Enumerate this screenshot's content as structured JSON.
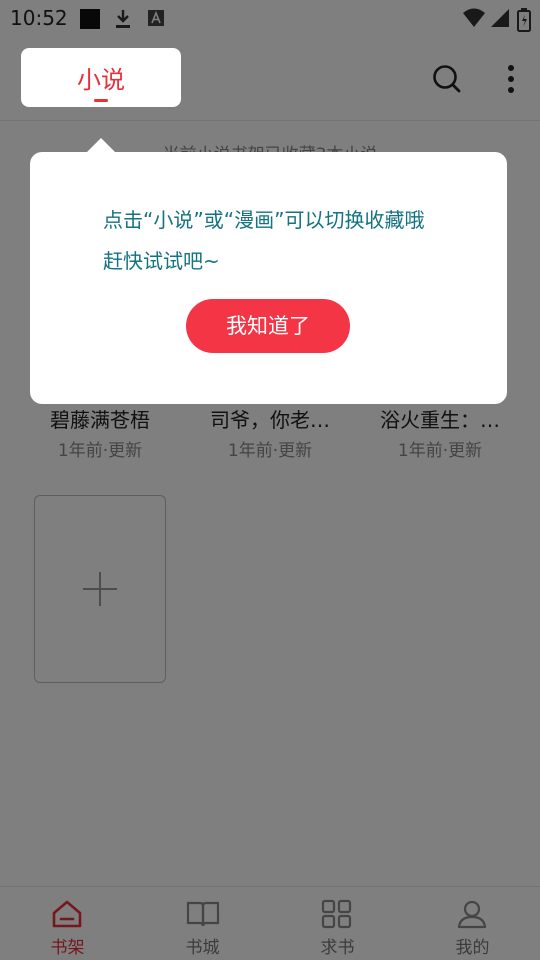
{
  "status_bar": {
    "time": "10:52"
  },
  "top_bar": {
    "active_tab": "小说"
  },
  "shelf": {
    "hint": "当前小说书架已收藏3本小说",
    "books": [
      {
        "title": "碧藤满苍梧",
        "updated": "1年前·更新"
      },
      {
        "title": "司爷，你老…",
        "updated": "1年前·更新"
      },
      {
        "title": "浴火重生：…",
        "updated": "1年前·更新"
      }
    ]
  },
  "dialog": {
    "line1": "点击“小说”或“漫画”可以切换收藏哦",
    "line2": "赶快试试吧~",
    "button": "我知道了"
  },
  "bottom_nav": {
    "items": [
      {
        "label": "书架",
        "icon": "home-icon",
        "active": true
      },
      {
        "label": "书城",
        "icon": "book-icon"
      },
      {
        "label": "求书",
        "icon": "grid-icon"
      },
      {
        "label": "我的",
        "icon": "user-icon"
      }
    ]
  },
  "colors": {
    "accent": "#e8303a",
    "button": "#f33546",
    "dialog_text": "#13737f"
  }
}
